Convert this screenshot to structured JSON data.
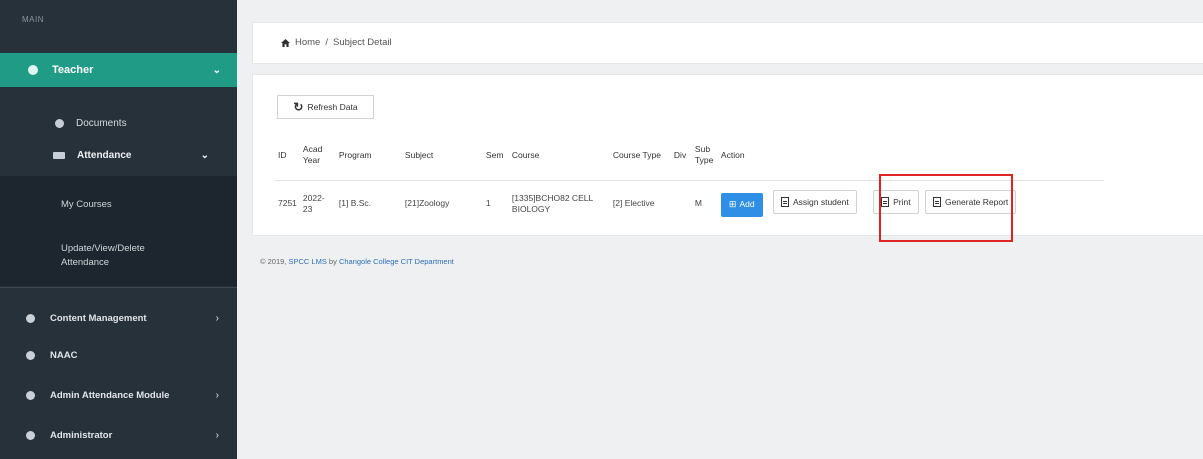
{
  "sidebar": {
    "menu_header": "MAIN",
    "teacher": {
      "label": "Teacher",
      "chevron": "⌄"
    },
    "documents": "Documents",
    "attendance": {
      "label": "Attendance",
      "chevron": "⌄"
    },
    "my_courses": "My Courses",
    "update_attendance": "Update/View/Delete Attendance",
    "nav": [
      {
        "label": "Content Management",
        "chevron": "›"
      },
      {
        "label": "NAAC",
        "chevron": ""
      },
      {
        "label": "Admin Attendance Module",
        "chevron": "›"
      },
      {
        "label": "Administrator",
        "chevron": "›"
      }
    ]
  },
  "breadcrumb": {
    "home": "Home",
    "separator": "/",
    "current": "Subject Detail"
  },
  "toolbar": {
    "refresh_label": "Refresh Data"
  },
  "table": {
    "headers": {
      "id": "ID",
      "acad_year": "Acad Year",
      "program": "Program",
      "subject": "Subject",
      "sem": "Sem",
      "course": "Course",
      "course_type": "Course Type",
      "div": "Div",
      "sub_type": "Sub Type",
      "action": "Action"
    },
    "row": {
      "id": "7251",
      "acad_year": "2022-23",
      "program": "[1] B.Sc.",
      "subject": "[21]Zoology",
      "sem": "1",
      "course": "[1335]BCHO82 CELL BIOLOGY",
      "course_type": "[2] Elective",
      "div": "",
      "sub_type": "M"
    },
    "actions": {
      "add": "Add",
      "assign": "Assign student",
      "print": "Print",
      "report": "Generate Report"
    }
  },
  "footer": {
    "prefix": "© 2019,",
    "app": "SPCC LMS",
    "by": "by",
    "dept": "Changole College CIT Department"
  },
  "colors": {
    "sidebar": "#27313a",
    "active": "#1f9b86",
    "add": "#2f8fe6",
    "highlight": "#e02424"
  }
}
